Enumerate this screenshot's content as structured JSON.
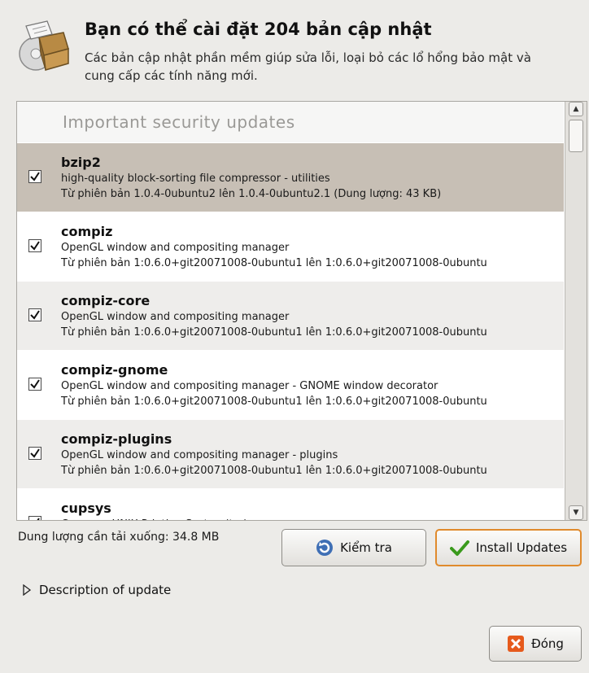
{
  "header": {
    "icon": "package-box-icon",
    "title": "Bạn có thể cài đặt 204 bản cập nhật",
    "subtitle": "Các bản cập nhật phần mềm giúp sửa lỗi, loại bỏ các lổ hổng bảo mật và cung cấp các tính năng mới."
  },
  "updates": {
    "section_title": "Important security updates",
    "items": [
      {
        "name": "bzip2",
        "desc": "high-quality block-sorting file compressor - utilities",
        "version": "Từ phiên bản 1.0.4-0ubuntu2 lên 1.0.4-0ubuntu2.1 (Dung lượng: 43 KB)",
        "checked": true,
        "selected": true
      },
      {
        "name": "compiz",
        "desc": "OpenGL window and compositing manager",
        "version": "Từ phiên bản 1:0.6.0+git20071008-0ubuntu1 lên 1:0.6.0+git20071008-0ubuntu",
        "checked": true,
        "selected": false
      },
      {
        "name": "compiz-core",
        "desc": "OpenGL window and compositing manager",
        "version": "Từ phiên bản 1:0.6.0+git20071008-0ubuntu1 lên 1:0.6.0+git20071008-0ubuntu",
        "checked": true,
        "selected": false
      },
      {
        "name": "compiz-gnome",
        "desc": "OpenGL window and compositing manager - GNOME window decorator",
        "version": "Từ phiên bản 1:0.6.0+git20071008-0ubuntu1 lên 1:0.6.0+git20071008-0ubuntu",
        "checked": true,
        "selected": false
      },
      {
        "name": "compiz-plugins",
        "desc": "OpenGL window and compositing manager - plugins",
        "version": "Từ phiên bản 1:0.6.0+git20071008-0ubuntu1 lên 1:0.6.0+git20071008-0ubuntu",
        "checked": true,
        "selected": false
      },
      {
        "name": "cupsys",
        "desc": "Common UNIX Printing System(tm) - server",
        "version": "",
        "checked": true,
        "selected": false
      }
    ]
  },
  "download_size": "Dung lượng cần tải xuống: 34.8 MB",
  "buttons": {
    "check": {
      "label": "Kiểm tra",
      "icon": "refresh-icon"
    },
    "install": {
      "label": "Install Updates",
      "icon": "checkmark-icon"
    },
    "close": {
      "label": "Đóng",
      "icon": "close-icon"
    }
  },
  "description_expander": {
    "label": "Description of update",
    "icon": "triangle-right-icon"
  },
  "colors": {
    "selected_row": "#c7bfb5",
    "install_border": "#e08a2c",
    "check_green": "#3a9a1c",
    "close_orange": "#e65a1c"
  }
}
